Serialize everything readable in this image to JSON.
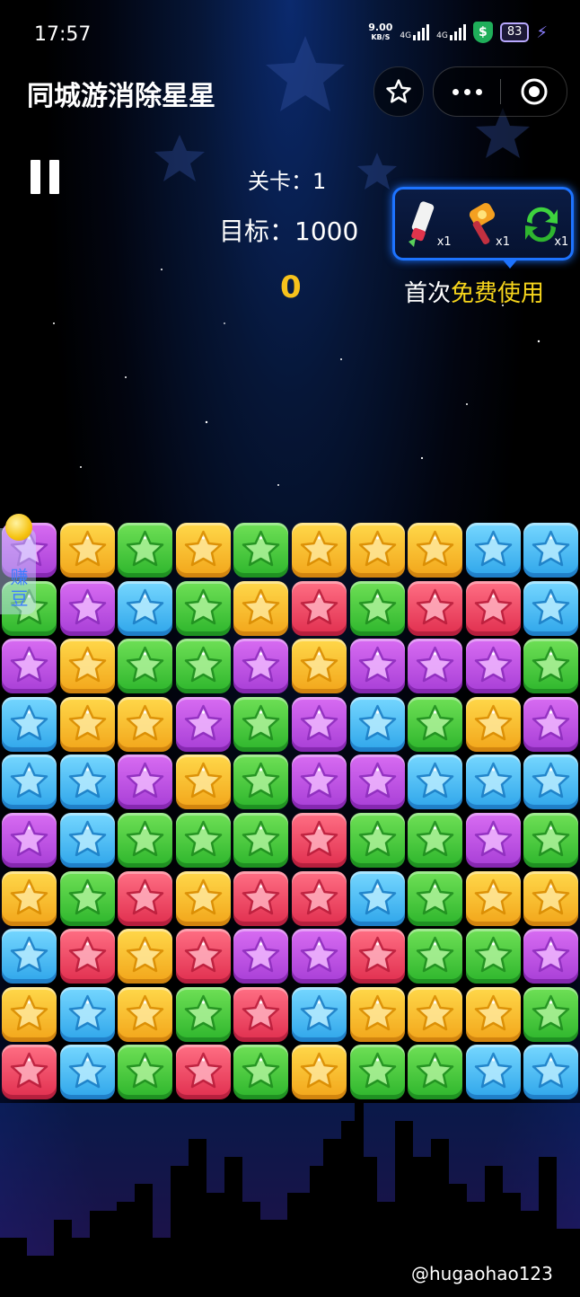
{
  "status_bar": {
    "time": "17:57",
    "net_speed_value": "9.00",
    "net_speed_unit": "KB/S",
    "signal_1": "4G",
    "signal_2": "4G",
    "battery": "83"
  },
  "header": {
    "title": "同城游消除星星"
  },
  "hud": {
    "level": "关卡：1",
    "target": "目标：1000",
    "score": "0"
  },
  "tools": {
    "items": [
      {
        "name": "brush",
        "count": "x1"
      },
      {
        "name": "hammer",
        "count": "x1"
      },
      {
        "name": "refresh",
        "count": "x1"
      }
    ],
    "free_prefix": "首次",
    "free_highlight": "免费使用"
  },
  "side": {
    "earn_label": "赚豆"
  },
  "board": {
    "rows": [
      [
        "purple",
        "yellow",
        "green",
        "yellow",
        "green",
        "yellow",
        "yellow",
        "yellow",
        "blue",
        "blue"
      ],
      [
        "green",
        "purple",
        "blue",
        "green",
        "yellow",
        "red",
        "green",
        "red",
        "red",
        "blue"
      ],
      [
        "purple",
        "yellow",
        "green",
        "green",
        "purple",
        "yellow",
        "purple",
        "purple",
        "purple",
        "green"
      ],
      [
        "blue",
        "yellow",
        "yellow",
        "purple",
        "green",
        "purple",
        "blue",
        "green",
        "yellow",
        "purple"
      ],
      [
        "blue",
        "blue",
        "purple",
        "yellow",
        "green",
        "purple",
        "purple",
        "blue",
        "blue",
        "blue"
      ],
      [
        "purple",
        "blue",
        "green",
        "green",
        "green",
        "red",
        "green",
        "green",
        "purple",
        "green"
      ],
      [
        "yellow",
        "green",
        "red",
        "yellow",
        "red",
        "red",
        "blue",
        "green",
        "yellow",
        "yellow"
      ],
      [
        "blue",
        "red",
        "yellow",
        "red",
        "purple",
        "purple",
        "red",
        "green",
        "green",
        "purple"
      ],
      [
        "yellow",
        "blue",
        "yellow",
        "green",
        "red",
        "blue",
        "yellow",
        "yellow",
        "yellow",
        "green"
      ],
      [
        "red",
        "blue",
        "green",
        "red",
        "green",
        "yellow",
        "green",
        "green",
        "blue",
        "blue"
      ]
    ]
  },
  "watermark": "@hugaohao123"
}
